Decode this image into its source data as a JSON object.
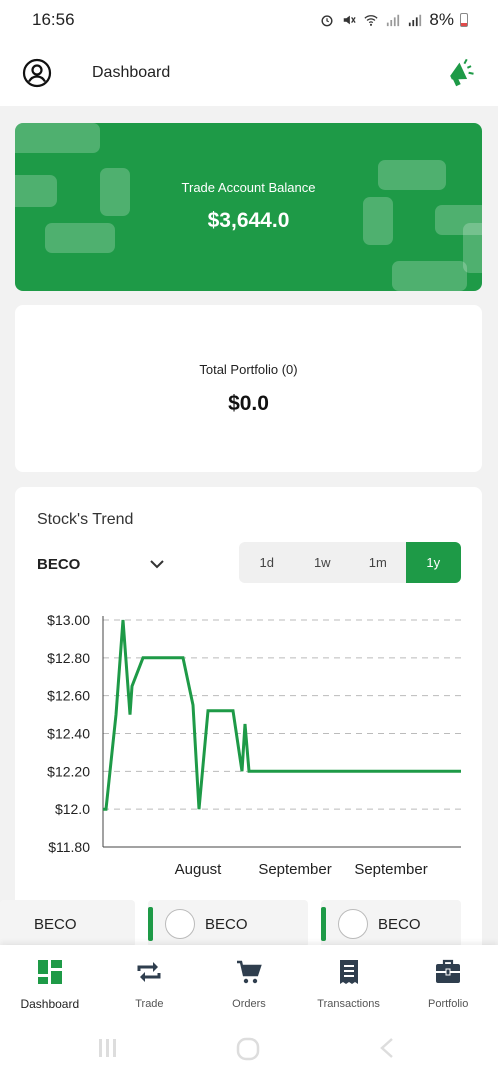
{
  "status_bar": {
    "time": "16:56",
    "battery": "8%"
  },
  "header": {
    "title": "Dashboard",
    "profile_icon": "user-circle-icon",
    "announce_icon": "megaphone-icon"
  },
  "balance": {
    "label": "Trade Account Balance",
    "value": "$3,644.0"
  },
  "portfolio": {
    "label": "Total Portfolio (0)",
    "value": "$0.0"
  },
  "trend": {
    "title": "Stock's Trend",
    "symbol": "BECO",
    "ranges": [
      {
        "label": "1d",
        "active": false
      },
      {
        "label": "1w",
        "active": false
      },
      {
        "label": "1m",
        "active": false
      },
      {
        "label": "1y",
        "active": true
      }
    ]
  },
  "chart_data": {
    "type": "line",
    "ylim": [
      11.8,
      13.0
    ],
    "yticks": [
      "$13.00",
      "$12.80",
      "$12.60",
      "$12.40",
      "$12.20",
      "$12.0",
      "$11.80"
    ],
    "ytick_values": [
      13.0,
      12.8,
      12.6,
      12.4,
      12.2,
      12.0,
      11.8
    ],
    "xticks": [
      "August",
      "September",
      "September"
    ],
    "grid": true,
    "color": "#1e9a47",
    "series": [
      {
        "values": [
          12.0,
          12.0,
          12.5,
          13.0,
          12.5,
          12.65,
          12.8,
          12.8,
          12.8,
          12.8,
          12.55,
          12.0,
          12.52,
          12.52,
          12.52,
          12.2,
          12.45,
          12.2,
          12.2,
          12.2,
          12.2,
          12.2
        ]
      }
    ]
  },
  "mini_cards": [
    {
      "label": "BECO"
    },
    {
      "label": "BECO"
    },
    {
      "label": "BECO"
    }
  ],
  "bottom_nav": [
    {
      "label": "Dashboard",
      "icon": "dashboard-icon",
      "active": true
    },
    {
      "label": "Trade",
      "icon": "trade-icon",
      "active": false
    },
    {
      "label": "Orders",
      "icon": "cart-icon",
      "active": false
    },
    {
      "label": "Transactions",
      "icon": "receipt-icon",
      "active": false
    },
    {
      "label": "Portfolio",
      "icon": "briefcase-icon",
      "active": false
    }
  ],
  "colors": {
    "brand": "#1e9a47",
    "icon_dark": "#2f3e4e"
  }
}
